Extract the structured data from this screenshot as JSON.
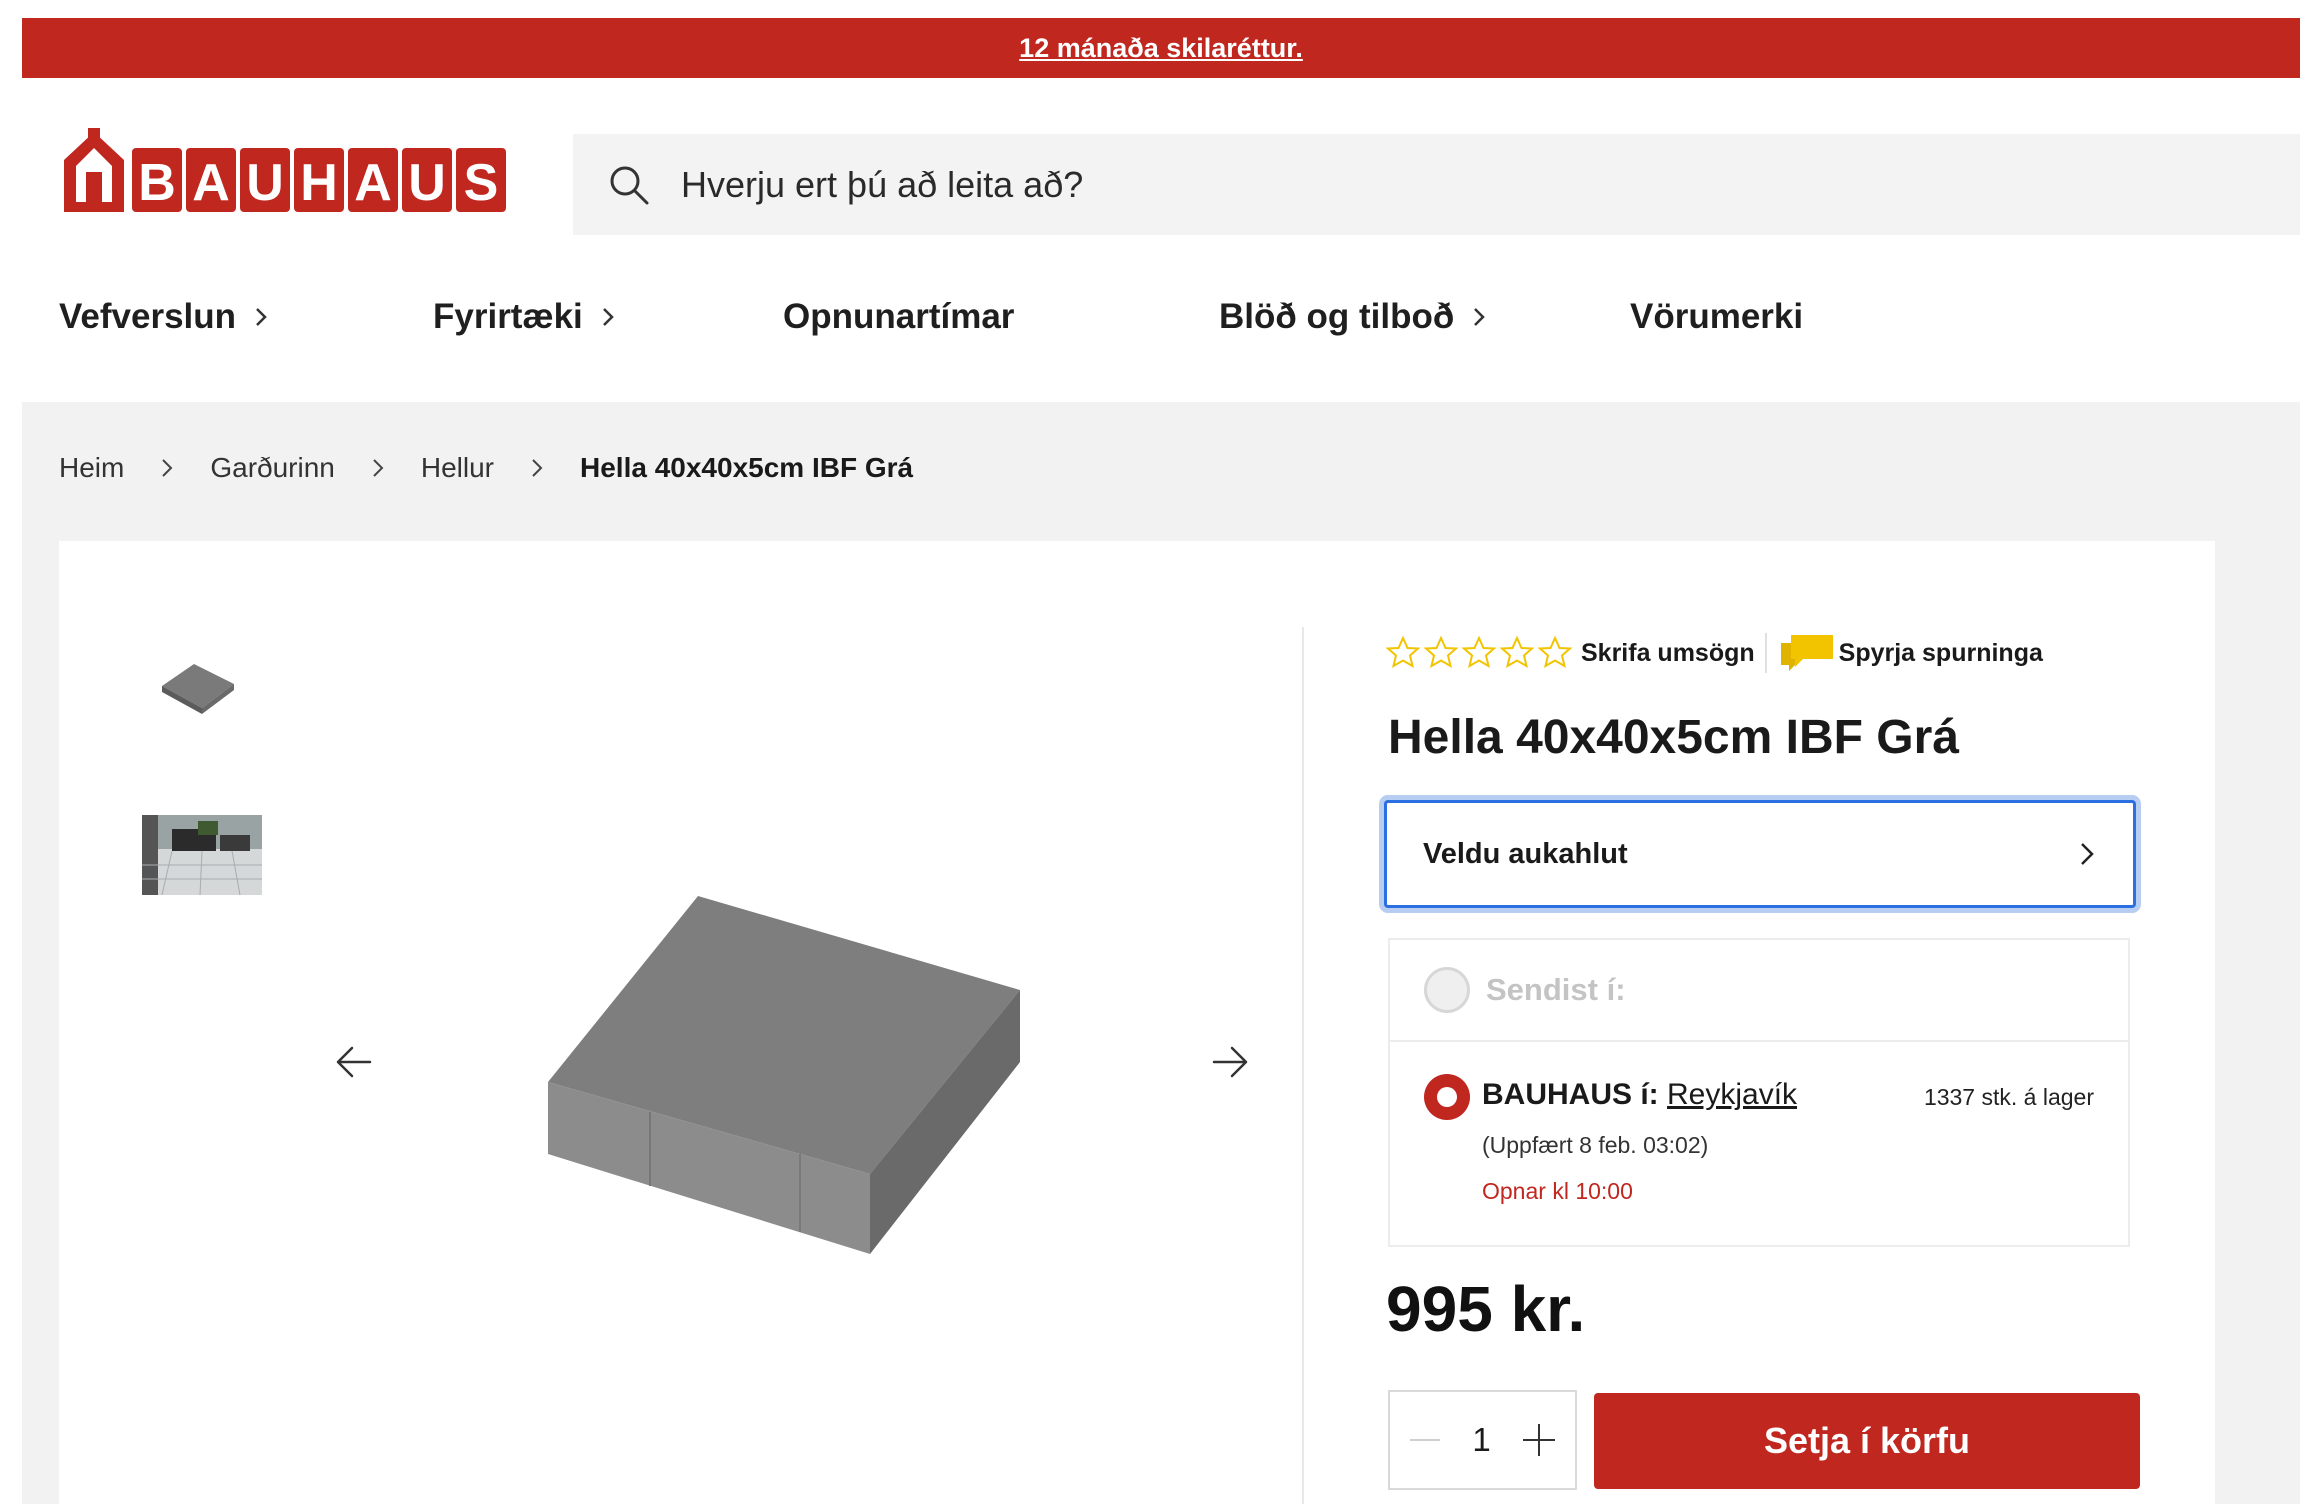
{
  "promo": {
    "text": "12 mánaða skilaréttur.",
    "color": "#c0271f"
  },
  "logo": {
    "text": "BAUHAUS"
  },
  "search": {
    "placeholder": "Hverju ert þú að leita að?",
    "icon": "search-icon"
  },
  "nav": {
    "items": [
      {
        "label": "Vefverslun",
        "has_chevron": true
      },
      {
        "label": "Fyrirtæki",
        "has_chevron": true
      },
      {
        "label": "Opnunartímar",
        "has_chevron": false
      },
      {
        "label": "Blöð og tilboð",
        "has_chevron": true
      },
      {
        "label": "Vörumerki",
        "has_chevron": false
      }
    ]
  },
  "breadcrumb": [
    "Heim",
    "Garðurinn",
    "Hellur",
    "Hella 40x40x5cm IBF Grá"
  ],
  "gallery": {
    "thumbnails": [
      "product-thumbnail",
      "lifestyle-thumbnail"
    ],
    "prev_icon": "arrow-left-icon",
    "next_icon": "arrow-right-icon"
  },
  "product": {
    "rating": {
      "stars_filled": 0,
      "stars_total": 5
    },
    "write_review": "Skrifa umsögn",
    "ask_question": "Spyrja spurninga",
    "title": "Hella 40x40x5cm IBF Grá",
    "accessory_label": "Veldu aukahlut",
    "delivery": {
      "ship_label": "Sendist í:",
      "store_prefix": "BAUHAUS í:",
      "store_city": "Reykjavík",
      "stock": "1337 stk. á lager",
      "updated": "(Uppfært 8 feb. 03:02)",
      "opens": "Opnar kl 10:00"
    },
    "price": "995 kr.",
    "quantity": "1",
    "add_to_cart": "Setja í körfu"
  },
  "colors": {
    "brand_red": "#c0271f",
    "focus_blue": "#2c6fe0",
    "star_yellow": "#f2c400"
  }
}
